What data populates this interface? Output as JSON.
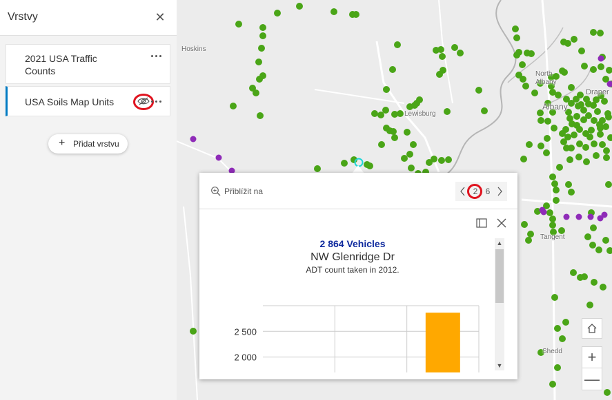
{
  "panel": {
    "title": "Vrstvy",
    "close_icon": "close-icon",
    "layers": [
      {
        "label": "2021 USA Traffic Counts",
        "more_icon": "more-horizontal-icon"
      },
      {
        "label": "USA Soils Map Units",
        "visibility_icon": "eye-icon",
        "more_icon": "more-horizontal-icon"
      }
    ],
    "add_layer_label": "Přidat vrstvu",
    "add_icon": "plus-icon"
  },
  "map": {
    "place_labels": [
      "Hoskins",
      "North Albany",
      "Albany",
      "Draper",
      "Lewisburg",
      "Tangent",
      "Shedd"
    ],
    "point_colors": {
      "traffic": "#4aa517",
      "soils": "#8f2bb8",
      "selected": "#21d6d6"
    },
    "controls": {
      "home_icon": "home-icon",
      "zoom_in": "+",
      "zoom_out": "—"
    }
  },
  "popup": {
    "zoom_to_label": "Přiblížit na",
    "zoom_icon": "magnifier-plus-icon",
    "pager": {
      "current": "2",
      "total": "6"
    },
    "dock_icon": "dock-icon",
    "close_icon": "close-icon",
    "title": "2 864 Vehicles",
    "street": "NW Glenridge Dr",
    "description": "ADT count taken in 2012."
  },
  "chart_data": {
    "type": "bar",
    "categories": [
      "",
      "",
      ""
    ],
    "values": [
      null,
      null,
      2864
    ],
    "bar_color": "#ffa800",
    "y_tick_labels": [
      "2 500",
      "2 000"
    ],
    "y_ticks": [
      2500,
      2000
    ],
    "ylim": [
      1700,
      3000
    ],
    "grid": true
  }
}
